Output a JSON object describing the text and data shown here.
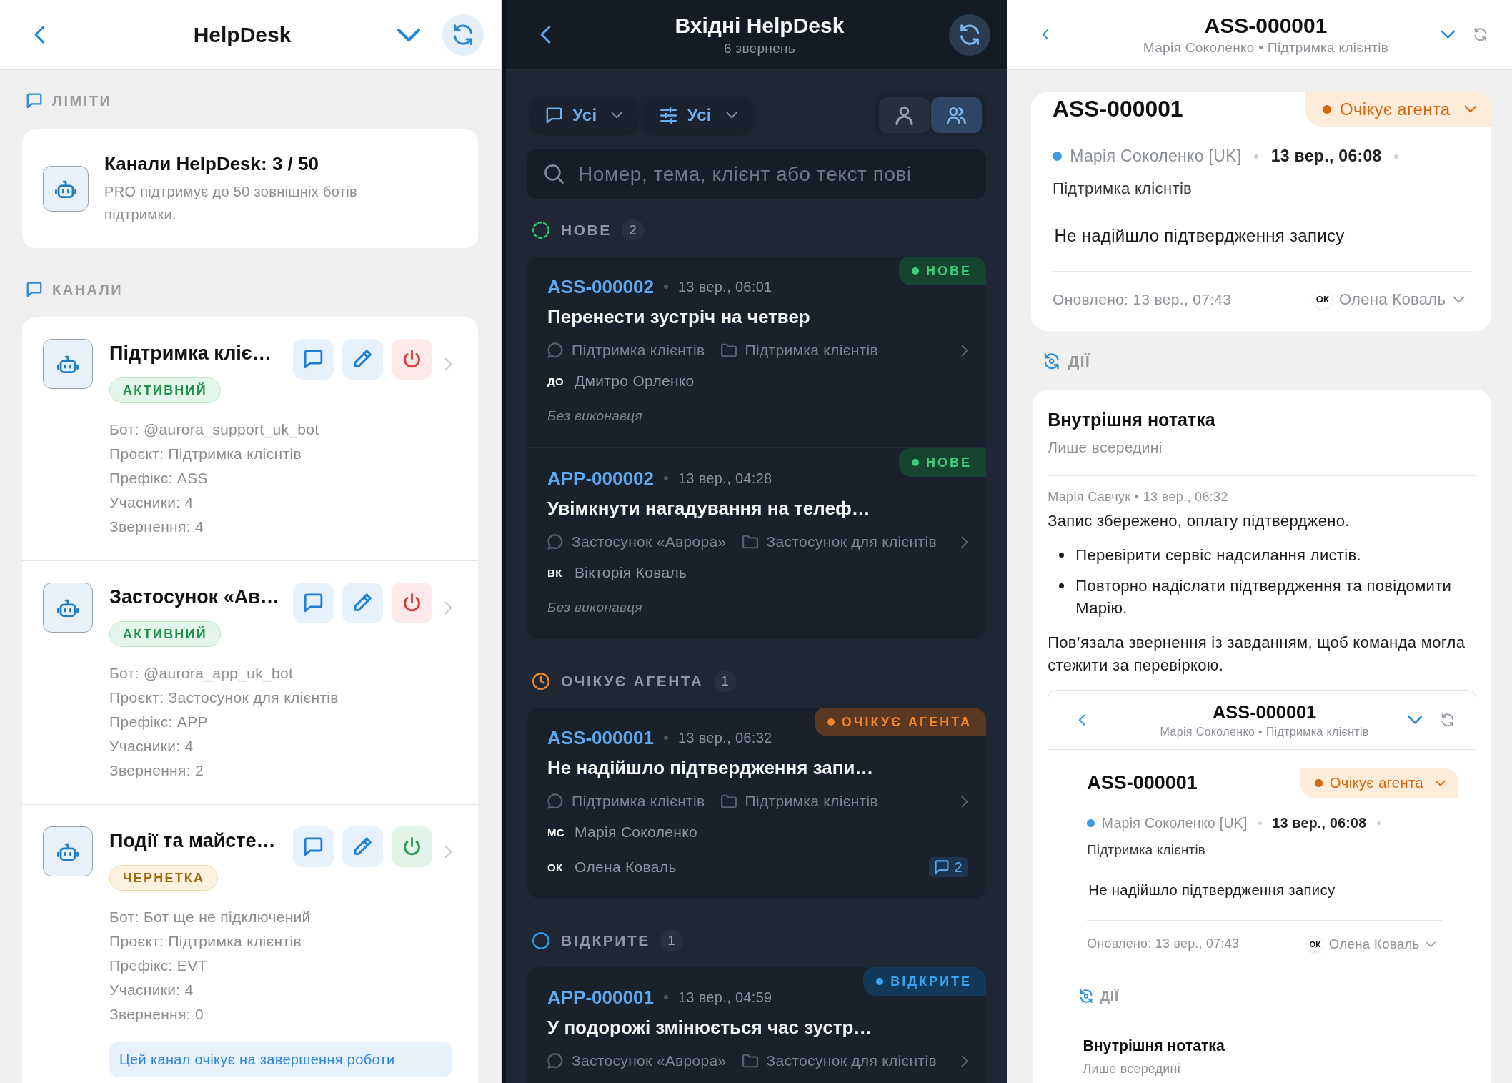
{
  "channels_screen": {
    "header": {
      "title": "HelpDesk"
    },
    "limits": {
      "label": "ЛІМІТИ",
      "title": "Канали HelpDesk: 3 / 50",
      "description": "PRO підтримує до 50 зовнішніх ботів підтримки."
    },
    "channels_label": "КАНАЛИ",
    "channels": [
      {
        "name": "Підтримка кліє…",
        "status": {
          "kind": "active",
          "label": "АКТИВНИЙ"
        },
        "details": [
          "Бот: @aurora_support_uk_bot",
          "Проєкт: Підтримка клієнтів",
          "Префікс: ASS",
          "Учасники: 4",
          "Звернення: 4"
        ]
      },
      {
        "name": "Застосунок «Ав…",
        "status": {
          "kind": "active",
          "label": "АКТИВНИЙ"
        },
        "details": [
          "Бот: @aurora_app_uk_bot",
          "Проєкт: Застосунок для клієнтів",
          "Префікс: APP",
          "Учасники: 4",
          "Звернення: 2"
        ]
      },
      {
        "name": "Події та майсте…",
        "status": {
          "kind": "draft",
          "label": "ЧЕРНЕТКА"
        },
        "details": [
          "Бот: Бот ще не підключений",
          "Проєкт: Підтримка клієнтів",
          "Префікс: EVT",
          "Учасники: 4",
          "Звернення: 0"
        ],
        "notice": "Цей канал очікує на завершення роботи"
      }
    ]
  },
  "inbox_screen": {
    "header": {
      "title": "Вхідні HelpDesk",
      "subtitle": "6 звернень"
    },
    "filters": [
      {
        "kind": "channel",
        "label": "Усі"
      },
      {
        "kind": "status",
        "label": "Усі"
      }
    ],
    "scope": [
      {
        "kind": "mine",
        "selected": false
      },
      {
        "kind": "team",
        "selected": true
      }
    ],
    "search": {
      "placeholder": "Номер, тема, клієнт або текст пові"
    },
    "groups": [
      {
        "kind": "new",
        "label": "НОВЕ",
        "count": "2",
        "tickets": [
          {
            "id": "ASS-000002",
            "time": "13 вер., 06:01",
            "status": {
              "kind": "new",
              "label": "НОВЕ"
            },
            "title": "Перенести зустріч на четвер",
            "channel": "Підтримка клієнтів",
            "project": "Підтримка клієнтів",
            "client": {
              "initials": "ДО",
              "name": "Дмитро Орленко"
            },
            "assignee": {
              "kind": "none",
              "label": "Без виконавця"
            }
          },
          {
            "id": "APP-000002",
            "time": "13 вер., 04:28",
            "status": {
              "kind": "new",
              "label": "НОВЕ"
            },
            "title": "Увімкнути нагадування на телеф…",
            "channel": "Застосунок «Аврора»",
            "project": "Застосунок для клієнтів",
            "client": {
              "initials": "ВК",
              "name": "Вікторія Коваль"
            },
            "assignee": {
              "kind": "none",
              "label": "Без виконавця"
            }
          }
        ]
      },
      {
        "kind": "waiting",
        "label": "ОЧІКУЄ АГЕНТА",
        "count": "1",
        "tickets": [
          {
            "id": "ASS-000001",
            "time": "13 вер., 06:32",
            "status": {
              "kind": "waiting",
              "label": "ОЧІКУЄ АГЕНТА"
            },
            "title": "Не надійшло підтвердження запи…",
            "channel": "Підтримка клієнтів",
            "project": "Підтримка клієнтів",
            "client": {
              "initials": "МС",
              "name": "Марія Соколенко"
            },
            "assignee": {
              "kind": "agent",
              "initials": "ОК",
              "name": "Олена Коваль"
            },
            "comments": "2"
          }
        ]
      },
      {
        "kind": "open",
        "label": "ВІДКРИТЕ",
        "count": "1",
        "tickets": [
          {
            "id": "APP-000001",
            "time": "13 вер., 04:59",
            "status": {
              "kind": "open",
              "label": "ВІДКРИТЕ"
            },
            "title": "У подорожі змінюється час зустр…",
            "channel": "Застосунок «Аврора»",
            "project": "Застосунок для клієнтів"
          }
        ]
      }
    ]
  },
  "ticket_screen": {
    "header": {
      "title": "ASS-000001",
      "subtitle": "Марія Соколенко • Підтримка клієнтів"
    },
    "ticket": {
      "id": "ASS-000001",
      "status": {
        "kind": "waiting",
        "label": "Очікує агента"
      },
      "client": "Марія Соколенко [UK]",
      "created": "13 вер., 06:08",
      "project": "Підтримка клієнтів",
      "subject": "Не надійшло підтвердження запису",
      "updated": "Оновлено: 13 вер., 07:43",
      "assignee": {
        "initials": "ОК",
        "name": "Олена Коваль"
      }
    },
    "actions_label": "ДІЇ",
    "note": {
      "title": "Внутрішня нотатка",
      "subtitle": "Лише всередині",
      "meta": "Марія Савчук • 13 вер., 06:32",
      "blocks": [
        {
          "kind": "paragraph",
          "text": "Запис збережено, оплату підтверджено."
        },
        {
          "kind": "list",
          "items": [
            "Перевірити сервіс надсилання листів.",
            "Повторно надіслати підтвердження та повідомити Марію."
          ]
        },
        {
          "kind": "paragraph",
          "text": "Пов’язала звернення із завданням, щоб команда могла стежити за перевіркою."
        },
        {
          "kind": "screenshot",
          "view": {
            "header": {
              "title": "ASS-000001",
              "subtitle": "Марія Соколенко • Підтримка клієнтів"
            },
            "ticket": {
              "id": "ASS-000001",
              "status": {
                "kind": "waiting",
                "label": "Очікує агента"
              },
              "client": "Марія Соколенко [UK]",
              "created": "13 вер., 06:08",
              "project": "Підтримка клієнтів",
              "subject": "Не надійшло підтвердження запису",
              "updated": "Оновлено: 13 вер., 07:43",
              "assignee": {
                "initials": "ОК",
                "name": "Олена Коваль"
              }
            },
            "actions_label": "ДІЇ",
            "note": {
              "title": "Внутрішня нотатка",
              "subtitle": "Лише всередині"
            }
          }
        }
      ]
    }
  }
}
